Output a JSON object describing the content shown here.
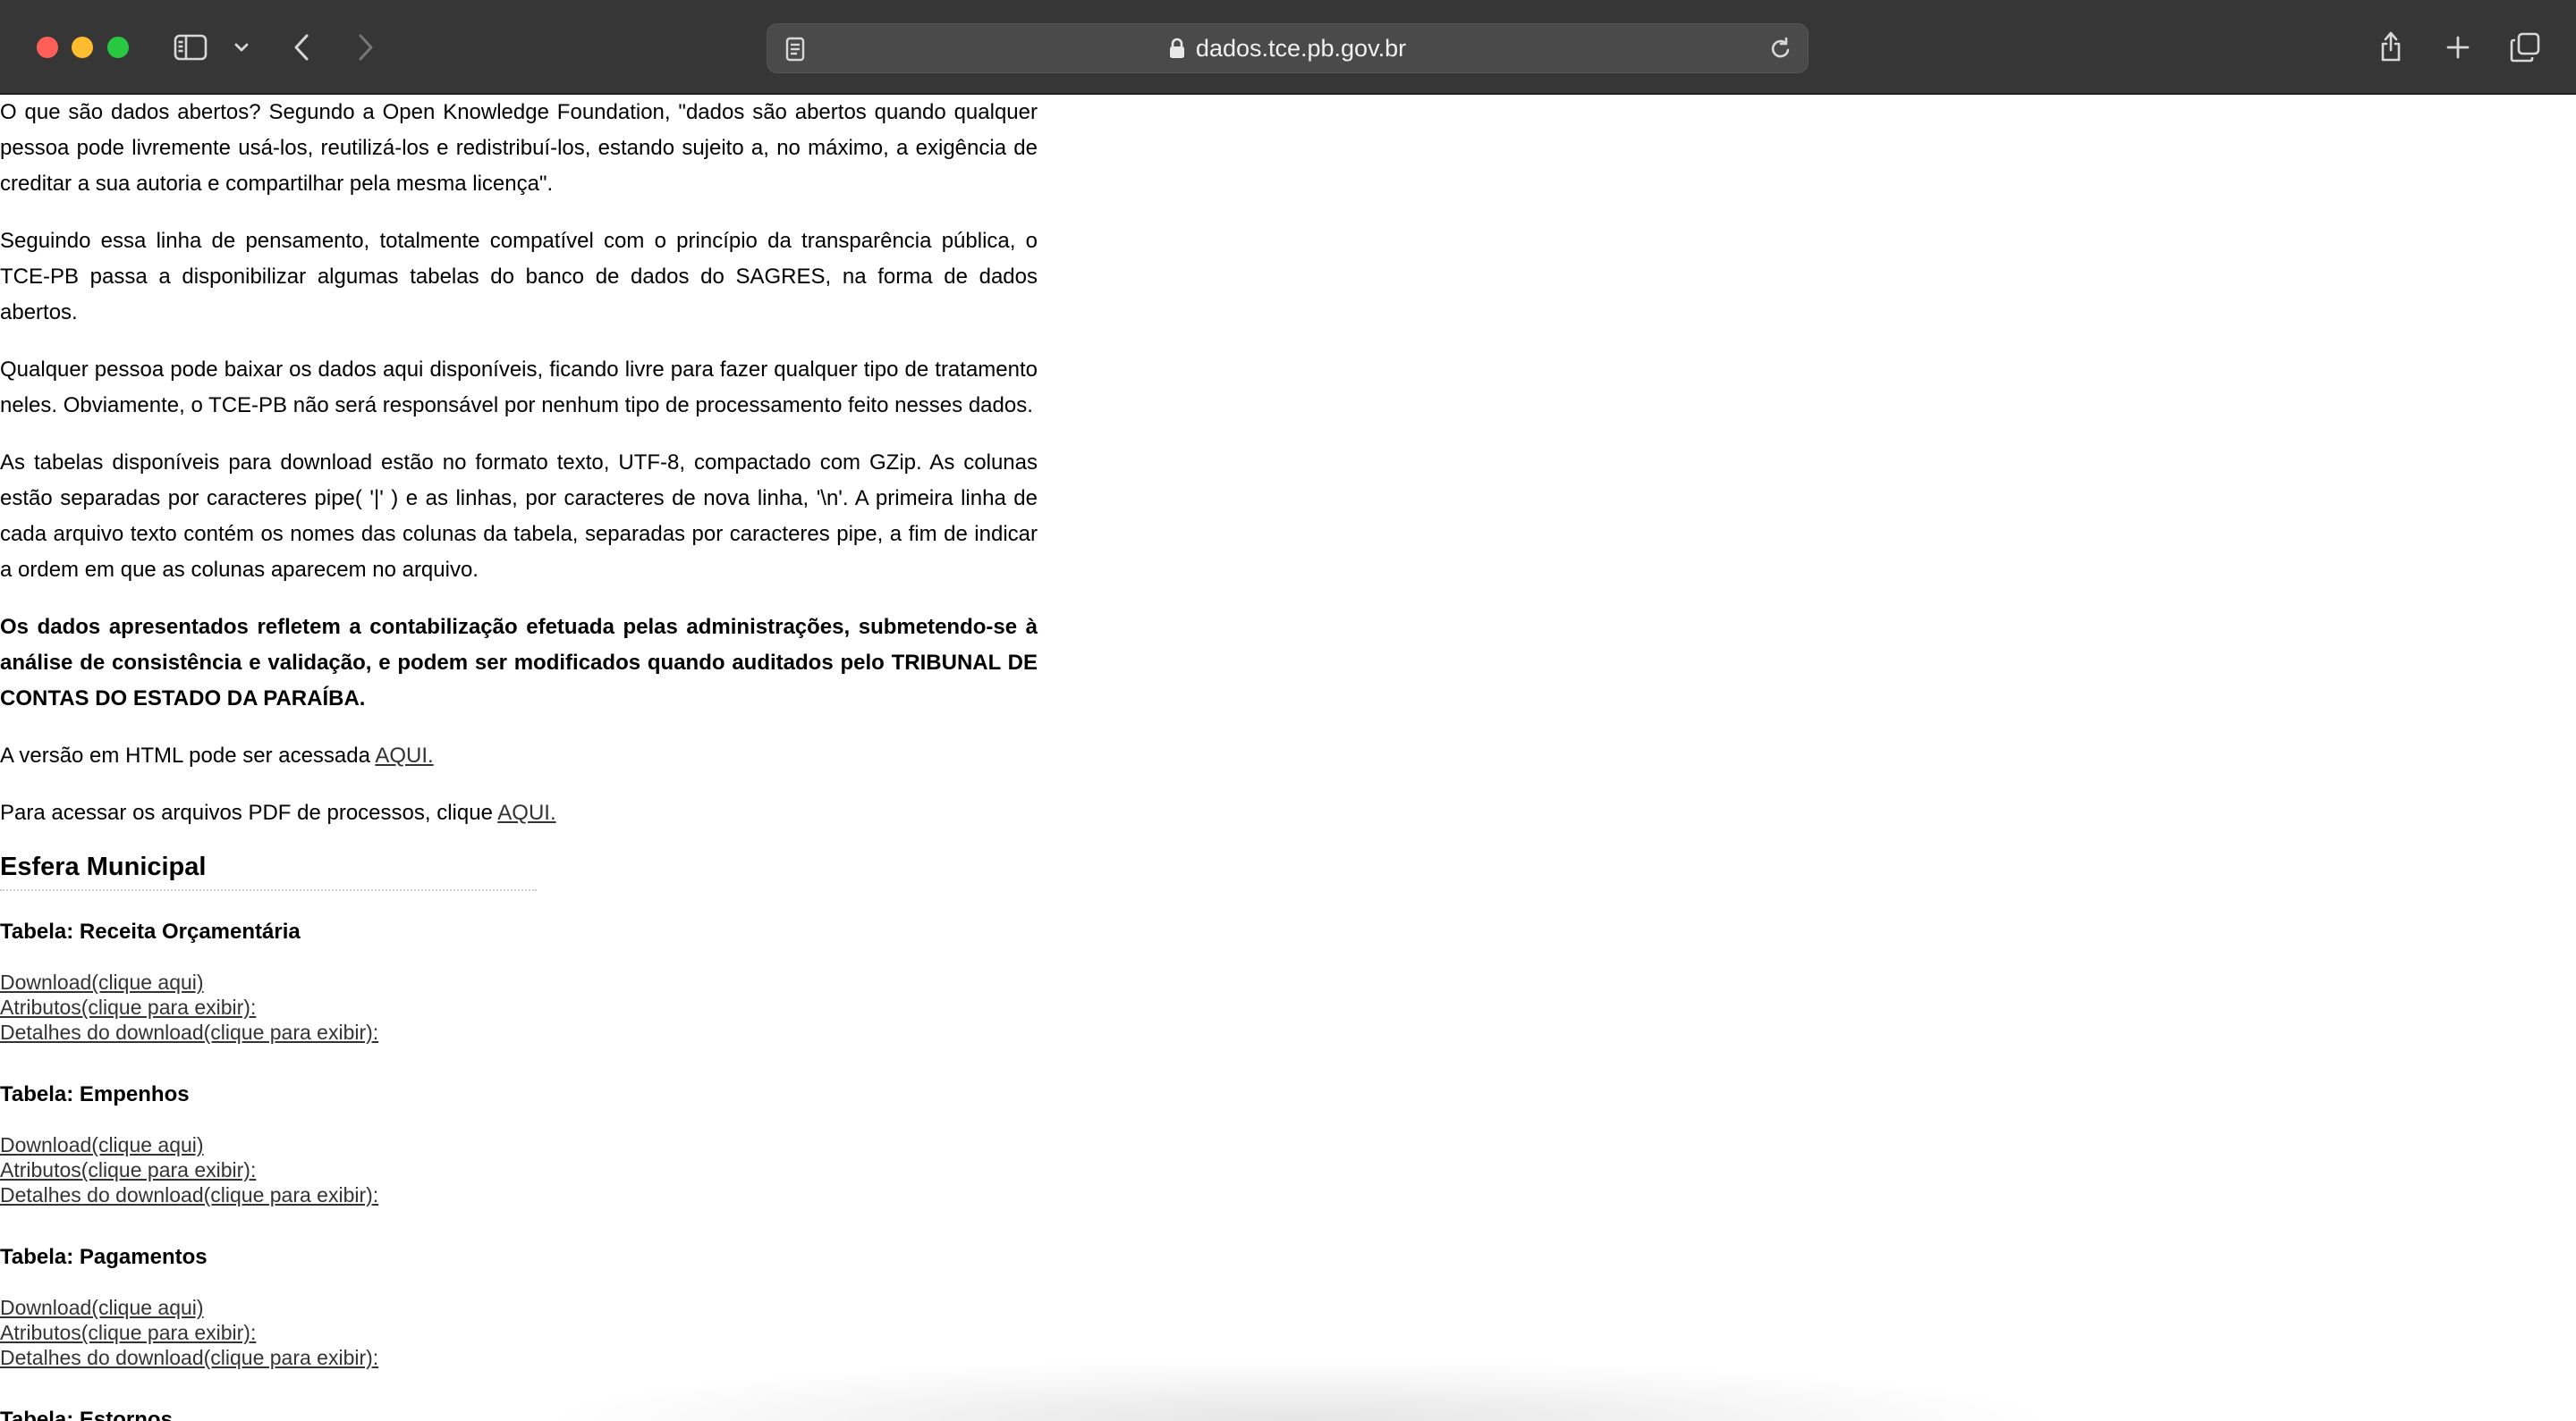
{
  "browser": {
    "url": "dados.tce.pb.gov.br",
    "icons": {
      "sidebar": "sidebar-icon",
      "chevron": "chevron-down-icon",
      "back": "back-arrow-icon",
      "forward": "forward-arrow-icon",
      "page": "page-icon",
      "lock": "lock-icon",
      "reload": "reload-icon",
      "share": "share-icon",
      "new_tab": "plus-icon",
      "tabs": "tabs-overview-icon"
    }
  },
  "content": {
    "para1": "O que são dados abertos? Segundo a Open Knowledge Foundation, \"dados são abertos quando qualquer pessoa pode livremente usá-los, reutilizá-los e redistribuí-los, estando sujeito a, no máximo, a exigência de creditar a sua autoria e compartilhar pela mesma licença\".",
    "para2": "Seguindo essa linha de pensamento, totalmente compatível com o princípio da transparência pública, o TCE-PB passa a disponibilizar algumas tabelas do banco de dados do SAGRES, na forma de dados abertos.",
    "para3": "Qualquer pessoa pode baixar os dados aqui disponíveis, ficando livre para fazer qualquer tipo de tratamento neles. Obviamente, o TCE-PB não será responsável por nenhum tipo de processamento feito nesses dados.",
    "para4": "As tabelas disponíveis para download estão no formato texto, UTF-8, compactado com GZip. As colunas estão separadas por caracteres pipe( '|' ) e as linhas, por caracteres de nova linha, '\\n'. A primeira linha de cada arquivo texto contém os nomes das colunas da tabela, separadas por caracteres pipe, a fim de indicar a ordem em que as colunas aparecem no arquivo.",
    "para5": "Os dados apresentados refletem a contabilização efetuada pelas administrações, submetendo-se à análise de consistência e validação, e podem ser modificados quando auditados pelo TRIBUNAL DE CONTAS DO ESTADO DA PARAÍBA.",
    "html_text": "A versão em HTML pode ser acessada ",
    "html_link": "AQUI.",
    "pdf_text": "Para acessar os arquivos PDF de processos, clique ",
    "pdf_link": "AQUI.",
    "section_title": "Esfera Municipal",
    "tables": [
      {
        "title": "Tabela: Receita Orçamentária",
        "download": "Download(clique aqui)",
        "attributes": "Atributos(clique para exibir):",
        "details": "Detalhes do download(clique para exibir):"
      },
      {
        "title": "Tabela: Empenhos",
        "download": "Download(clique aqui)",
        "attributes": "Atributos(clique para exibir):",
        "details": "Detalhes do download(clique para exibir):"
      },
      {
        "title": "Tabela: Pagamentos",
        "download": "Download(clique aqui)",
        "attributes": "Atributos(clique para exibir):",
        "details": "Detalhes do download(clique para exibir):"
      },
      {
        "title": "Tabela: Estornos"
      }
    ]
  }
}
